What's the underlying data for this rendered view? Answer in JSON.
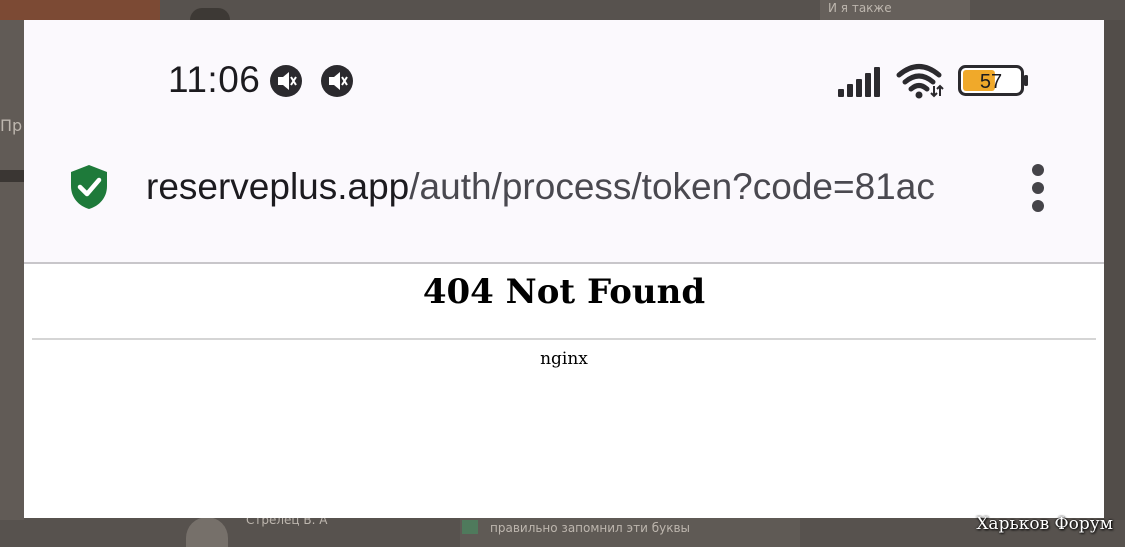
{
  "status_bar": {
    "time": "11:06",
    "notification_icons": [
      "speaker-mute-icon",
      "speaker-mute-icon"
    ],
    "battery_level": "57",
    "battery_fraction": 0.57,
    "battery_color": "#f0a92a",
    "signal_icon": "cellular-signal-icon",
    "wifi_icon": "wifi-icon"
  },
  "url_bar": {
    "security_icon": "shield-check-icon",
    "security_color": "#1e7a3a",
    "host": "reserveplus.app",
    "path": "/auth/process/token?code=81ac",
    "menu_icon": "more-vertical-icon"
  },
  "page": {
    "heading": "404 Not Found",
    "server": "nginx"
  },
  "background": {
    "watermark": "Харьков Форум",
    "snippets": {
      "top_right": "И я также",
      "bottom_author": "Стрелец В. А",
      "bottom_post": "правильно запомнил эти буквы",
      "left_fragment": "Пр"
    }
  }
}
